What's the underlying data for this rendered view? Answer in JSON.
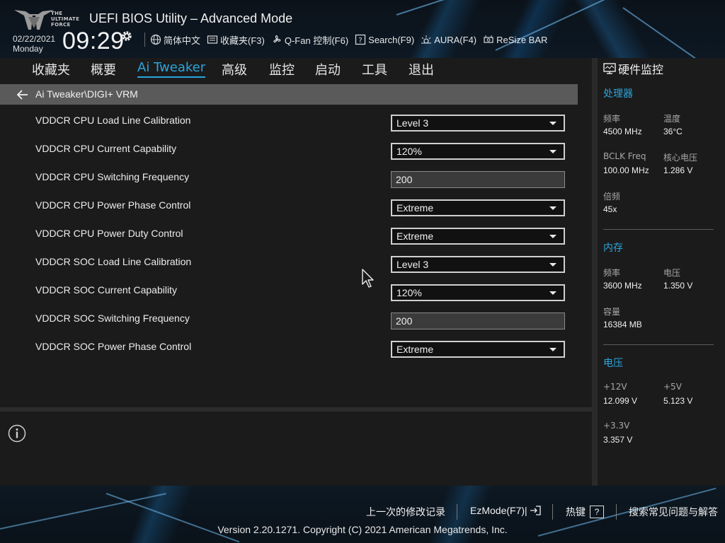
{
  "header": {
    "logo_lines": [
      "THE",
      "ULTIMATE",
      "FORCE"
    ],
    "title": "UEFI BIOS Utility – Advanced Mode",
    "date": "02/22/2021",
    "weekday": "Monday",
    "time": "09:29",
    "toolbar": [
      {
        "label": "简体中文",
        "icon": "globe-icon"
      },
      {
        "label": "收藏夹(F3)",
        "icon": "favorites-icon"
      },
      {
        "label": "Q-Fan 控制(F6)",
        "icon": "fan-icon"
      },
      {
        "label": "Search(F9)",
        "icon": "help-search-icon"
      },
      {
        "label": "AURA(F4)",
        "icon": "aura-light-icon"
      },
      {
        "label": "ReSize BAR",
        "icon": "resize-bar-icon"
      }
    ]
  },
  "nav": {
    "items": [
      "收藏夹",
      "概要",
      "Ai Tweaker",
      "高级",
      "监控",
      "启动",
      "工具",
      "退出"
    ],
    "active": "Ai Tweaker"
  },
  "breadcrumb": "Ai Tweaker\\DIGI+ VRM",
  "settings": [
    {
      "label": "VDDCR CPU Load Line Calibration",
      "value": "Level 3",
      "kind": "select"
    },
    {
      "label": "VDDCR CPU Current Capability",
      "value": "120%",
      "kind": "select"
    },
    {
      "label": "VDDCR CPU Switching Frequency",
      "value": "200",
      "kind": "text"
    },
    {
      "label": "VDDCR CPU Power Phase Control",
      "value": "Extreme",
      "kind": "select"
    },
    {
      "label": "VDDCR CPU Power Duty Control",
      "value": "Extreme",
      "kind": "select"
    },
    {
      "label": "VDDCR SOC Load Line Calibration",
      "value": "Level 3",
      "kind": "select"
    },
    {
      "label": "VDDCR SOC Current Capability",
      "value": "120%",
      "kind": "select"
    },
    {
      "label": "VDDCR SOC Switching Frequency",
      "value": "200",
      "kind": "text"
    },
    {
      "label": "VDDCR SOC Power Phase Control",
      "value": "Extreme",
      "kind": "select"
    }
  ],
  "hw_monitor": {
    "title": "硬件监控",
    "cpu": {
      "heading": "处理器",
      "freq_label": "频率",
      "freq": "4500 MHz",
      "temp_label": "温度",
      "temp": "36°C",
      "bclk_label": "BCLK Freq",
      "bclk": "100.00 MHz",
      "vcore_label": "核心电压",
      "vcore": "1.286 V",
      "ratio_label": "倍频",
      "ratio": "45x"
    },
    "memory": {
      "heading": "内存",
      "freq_label": "频率",
      "freq": "3600 MHz",
      "volt_label": "电压",
      "volt": "1.350 V",
      "cap_label": "容量",
      "cap": "16384 MB"
    },
    "voltage": {
      "heading": "电压",
      "v12_label": "+12V",
      "v12": "12.099 V",
      "v5_label": "+5V",
      "v5": "5.123 V",
      "v33_label": "+3.3V",
      "v33": "3.357 V"
    }
  },
  "footer": {
    "last_modified": "上一次的修改记录",
    "ezmode": "EzMode(F7)|",
    "hotkeys": "热键",
    "hotkey_badge": "?",
    "faq": "搜索常见问题与解答",
    "copyright": "Version 2.20.1271. Copyright (C) 2021 American Megatrends, Inc."
  },
  "colors": {
    "accent": "#2aa5de",
    "field_border": "#d0d0d0",
    "crumb_bg": "#5a5a5a"
  }
}
